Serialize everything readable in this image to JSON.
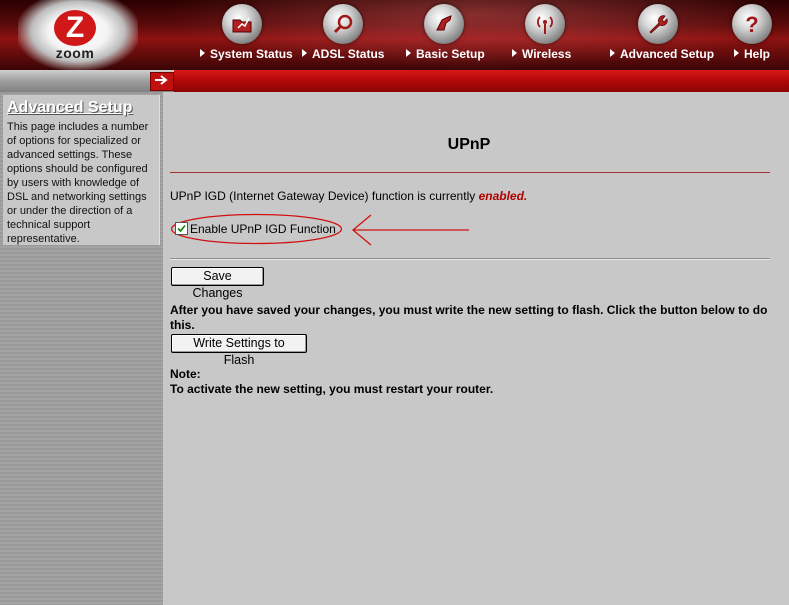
{
  "brand": {
    "logo_letter": "Z",
    "logo_text": "zoom"
  },
  "nav": [
    {
      "label": "System Status",
      "icon": "folder-chart-icon"
    },
    {
      "label": "ADSL Status",
      "icon": "magnifier-icon"
    },
    {
      "label": "Basic Setup",
      "icon": "hand-pointer-icon"
    },
    {
      "label": "Wireless",
      "icon": "wireless-antenna-icon"
    },
    {
      "label": "Advanced Setup",
      "icon": "wrench-icon"
    },
    {
      "label": "Help",
      "icon": "question-mark-icon"
    }
  ],
  "sidebar": {
    "title": "Advanced Setup",
    "description": "This page includes a number of options for specialized or advanced settings. These options should be configured by users with knowledge of DSL and networking settings or under the direction of a technical support representative."
  },
  "main": {
    "title": "UPnP",
    "status_prefix": "UPnP IGD (Internet Gateway Device) function is currently ",
    "status_value": "enabled.",
    "checkbox_label": "Enable UPnP IGD Function",
    "checkbox_checked": true,
    "save_button": "Save Changes",
    "after_text": "After you have saved your changes, you must write the new setting to flash. Click the button below to do this.",
    "flash_button": "Write Settings to Flash",
    "note_label": "Note:",
    "note_text": "To activate the new setting, you must restart your router."
  },
  "colors": {
    "header_red": "#8e1212",
    "strip_red": "#b80c0c",
    "status_enabled": "#b00000",
    "callout_red": "#d01010",
    "panel_gray": "#c8c8c8"
  }
}
